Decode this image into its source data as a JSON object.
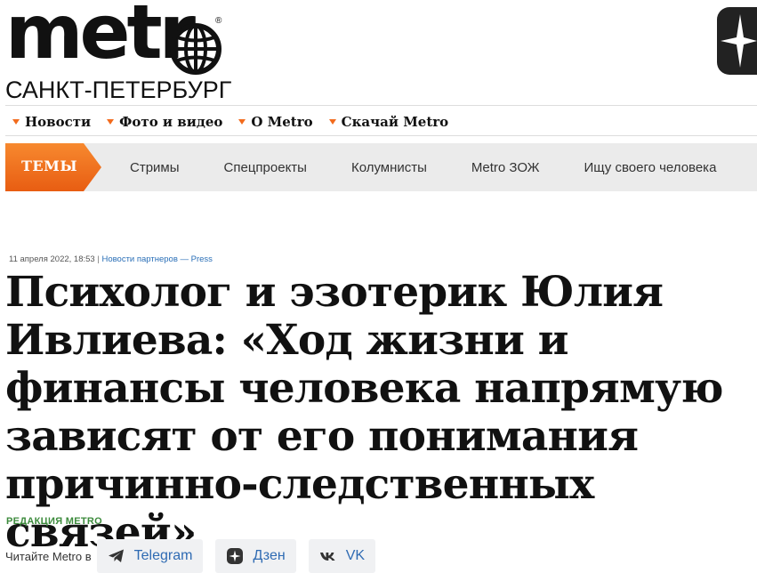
{
  "header": {
    "logo_text": "metr",
    "registered_mark": "®",
    "city": "САНКТ-ПЕТЕРБУРГ"
  },
  "topnav": {
    "items": [
      {
        "label": "Новости"
      },
      {
        "label": "Фото и видео"
      },
      {
        "label": "О Metro"
      },
      {
        "label": "Скачай Metro"
      }
    ]
  },
  "themes": {
    "tag": "ТЕМЫ",
    "links": [
      {
        "label": "Стримы"
      },
      {
        "label": "Спецпроекты"
      },
      {
        "label": "Колумнисты"
      },
      {
        "label": "Metro ЗОЖ"
      },
      {
        "label": "Ищу своего человека"
      }
    ]
  },
  "article": {
    "date": "11 апреля 2022, 18:53",
    "separator": "|",
    "category": "Новости партнеров — Press",
    "title": "Психолог и эзотерик Юлия Ивлиева: «Ход жизни и финансы человека напрямую зависят от его понимания причинно-следственных связей»",
    "author": "РЕДАКЦИЯ METRO"
  },
  "subscribe": {
    "label": "Читайте Metro в",
    "buttons": [
      {
        "label": "Telegram",
        "icon": "telegram-icon"
      },
      {
        "label": "Дзен",
        "icon": "dzen-icon"
      },
      {
        "label": "VK",
        "icon": "vk-icon"
      }
    ]
  },
  "colors": {
    "accent": "#f26b1d",
    "link": "#2f6bb3",
    "author": "#3d8b3d",
    "themes_bg": "#ebebeb"
  }
}
